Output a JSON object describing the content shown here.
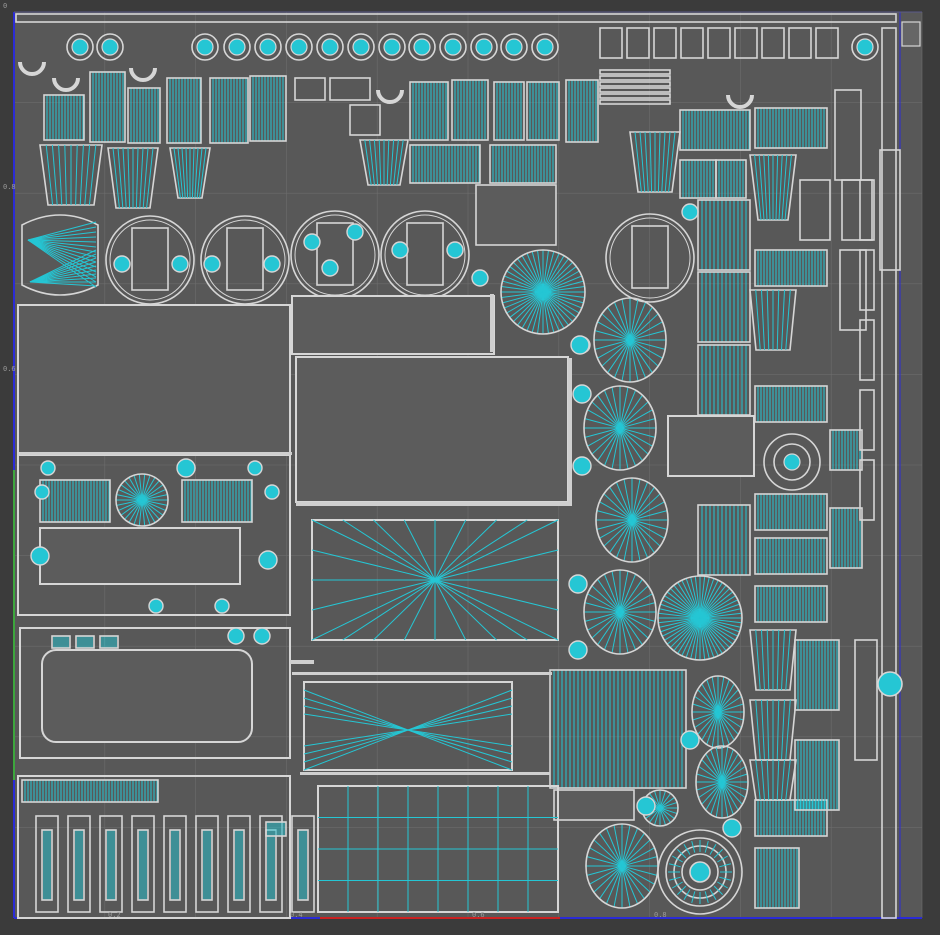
{
  "viewport": {
    "background": "#3b3b3b",
    "canvas_fill": "#585858",
    "wire_color": "#d6d6d6",
    "seam_color": "#25c6d4",
    "grid_color": "#6d6d6d",
    "axis_u_color": "#2b2bd6",
    "axis_v_color": "#3da63d",
    "axis_red_color": "#cc2222"
  },
  "rulers": {
    "left": [
      "0",
      "0.8",
      "0.6"
    ],
    "bottom": [
      "0.2",
      "0.4",
      "0.6",
      "0.8"
    ]
  }
}
